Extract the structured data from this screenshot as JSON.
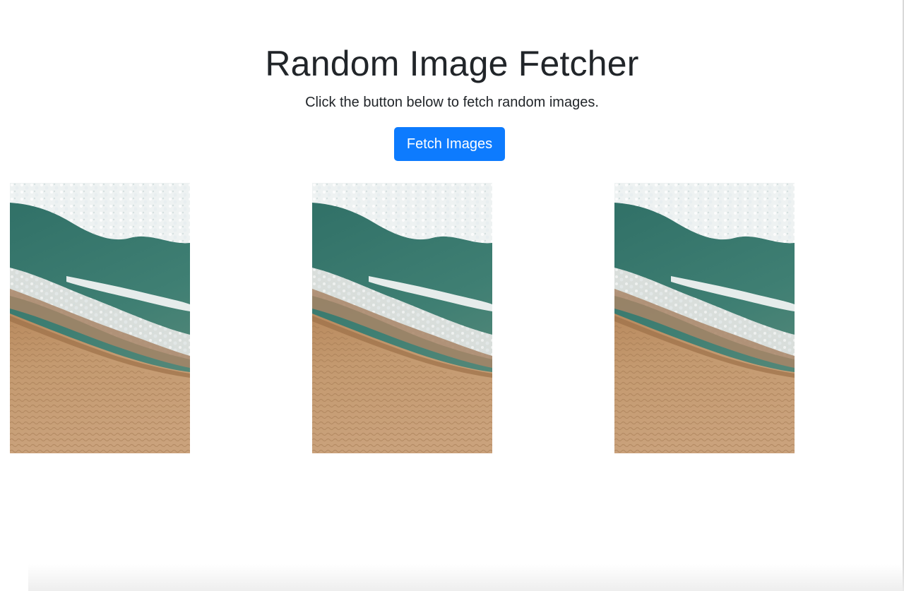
{
  "header": {
    "title": "Random Image Fetcher",
    "subtitle": "Click the button below to fetch random images."
  },
  "actions": {
    "fetch_label": "Fetch Images",
    "button_color": "#0d7bfe"
  },
  "gallery": {
    "images": [
      {
        "subject": "aerial beach shoreline with waves and sand"
      },
      {
        "subject": "aerial beach shoreline with waves and sand"
      },
      {
        "subject": "aerial beach shoreline with waves and sand"
      }
    ]
  },
  "colors": {
    "text": "#212529",
    "background": "#ffffff",
    "accent": "#0d7bfe"
  }
}
